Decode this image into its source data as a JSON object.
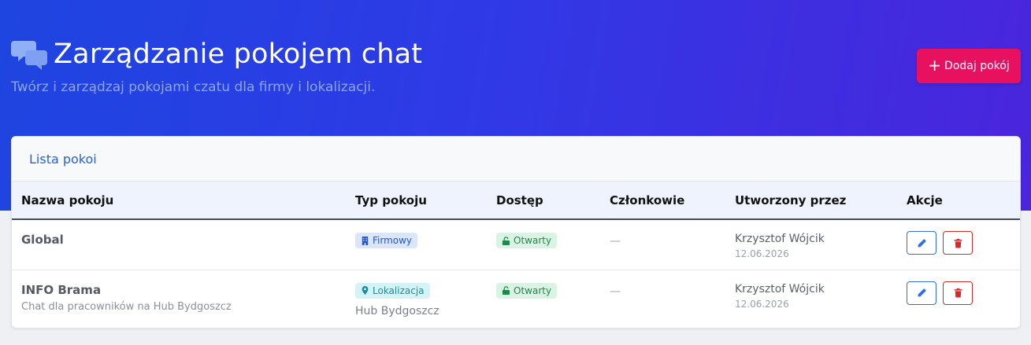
{
  "header": {
    "title": "Zarządzanie pokojem chat",
    "subtitle": "Twórz i zarządzaj pokojami czatu dla firmy i lokalizacji.",
    "add_button_label": "Dodaj pokój",
    "icon": "comments-icon"
  },
  "card": {
    "title": "Lista pokoi"
  },
  "table": {
    "columns": [
      "Nazwa pokoju",
      "Typ pokoju",
      "Dostęp",
      "Członkowie",
      "Utworzony przez",
      "Akcje"
    ],
    "rows": [
      {
        "name": "Global",
        "description": "",
        "type_label": "Firmowy",
        "type_icon": "building-icon",
        "type_sub": "",
        "access": "Otwarty",
        "members": "—",
        "created_by": "Krzysztof Wójcik",
        "created_date": "12.06.2026"
      },
      {
        "name": "INFO Brama",
        "description": "Chat dla pracowników na Hub Bydgoszcz",
        "type_label": "Lokalizacja",
        "type_icon": "map-marker-icon",
        "type_sub": "Hub Bydgoszcz",
        "access": "Otwarty",
        "members": "—",
        "created_by": "Krzysztof Wójcik",
        "created_date": "12.06.2026"
      }
    ]
  },
  "colors": {
    "hero_start": "#1e45e0",
    "hero_end": "#4a25dc",
    "accent_pink": "#e8115f",
    "link_blue": "#2563d9",
    "edit_blue": "#2f6ee0",
    "delete_red": "#d42a2a"
  }
}
